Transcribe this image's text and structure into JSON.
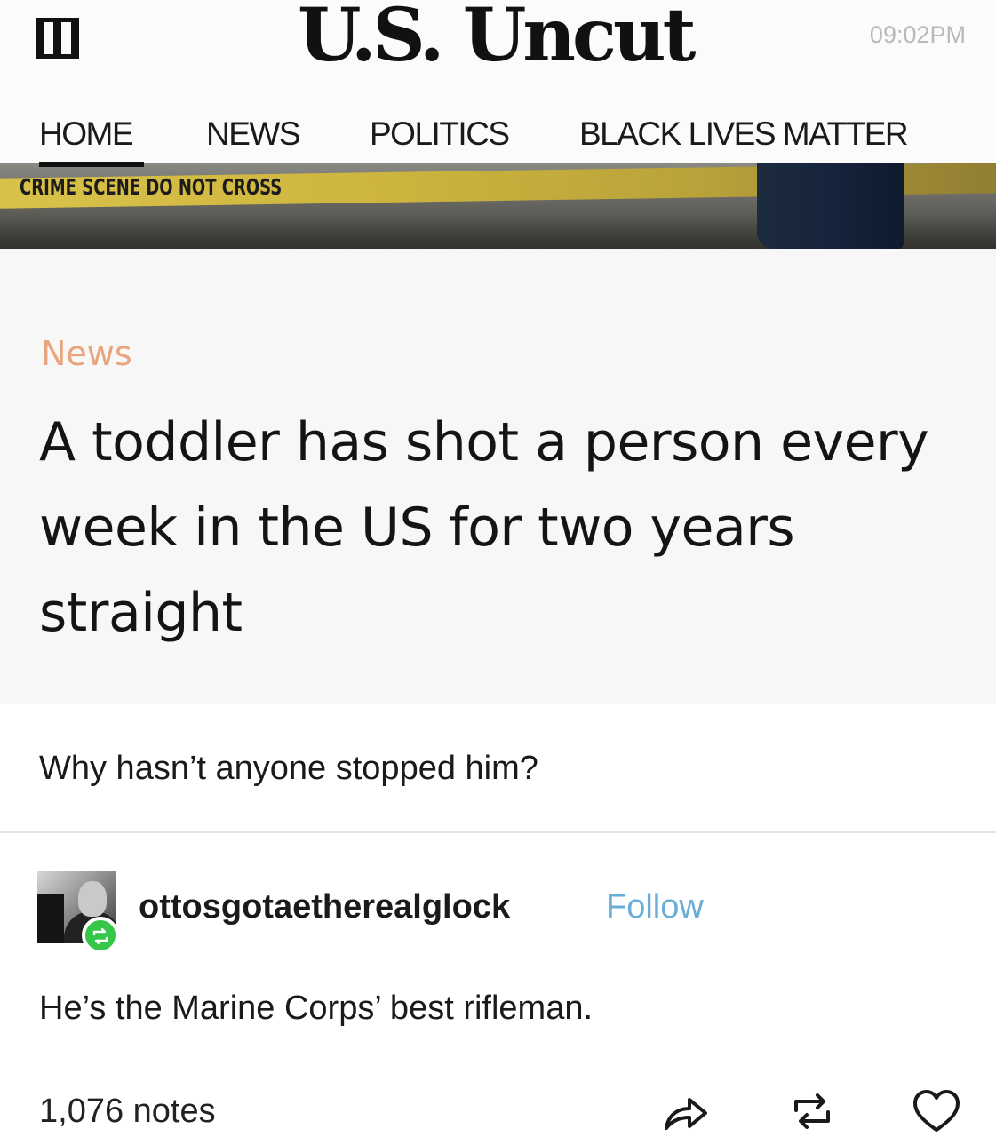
{
  "site": {
    "logo": "U.S. Uncut",
    "clock": "09:02PM",
    "menu_icon": "hamburger-menu-icon"
  },
  "nav": {
    "items": [
      {
        "label": "HOME",
        "active": true
      },
      {
        "label": "NEWS"
      },
      {
        "label": "POLITICS"
      },
      {
        "label": "BLACK LIVES MATTER"
      }
    ]
  },
  "hero": {
    "tape_text": "CRIME SCENE DO NOT CROSS"
  },
  "article": {
    "category": "News",
    "headline": "A toddler has shot a person every week in the US for two years straight"
  },
  "post": {
    "comment": "Why hasn’t anyone stopped him?",
    "username": "ottosgotaetherealglock",
    "follow_label": "Follow",
    "reply": "He’s the Marine Corps’ best rifleman.",
    "notes": "1,076 notes",
    "icons": {
      "share": "share-icon",
      "reblog": "reblog-icon",
      "like": "heart-icon",
      "reblog_badge": "reblog-badge-icon"
    }
  },
  "colors": {
    "category_accent": "#e8a47c",
    "follow_link": "#6aaed8",
    "reblog_green": "#35c64a",
    "clock_gray": "#b9b9b9"
  }
}
